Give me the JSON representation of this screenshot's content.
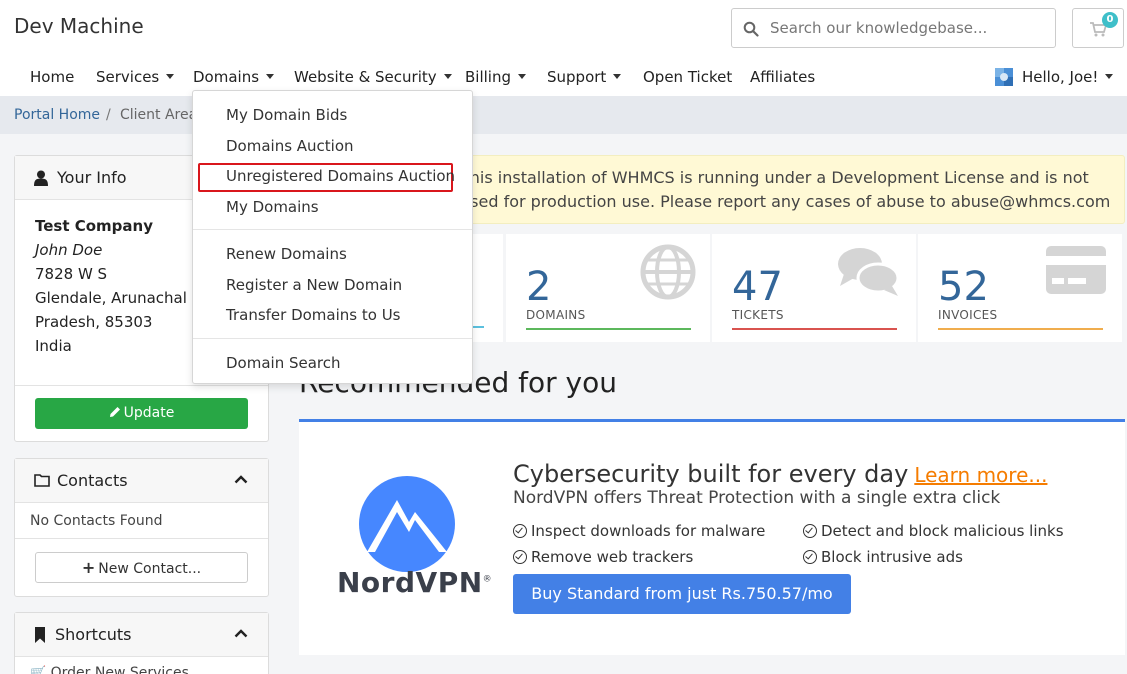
{
  "header": {
    "brand": "Dev Machine",
    "search_placeholder": "Search our knowledgebase...",
    "cart_count": "0"
  },
  "nav": {
    "home": "Home",
    "services": "Services",
    "domains": "Domains",
    "website_security": "Website & Security",
    "billing": "Billing",
    "support": "Support",
    "open_ticket": "Open Ticket",
    "affiliates": "Affiliates",
    "user": "Hello, Joe!"
  },
  "breadcrumb": {
    "portal_home": "Portal Home",
    "separator": "/",
    "client_area": "Client Area"
  },
  "domains_menu": {
    "items": [
      "My Domain Bids",
      "Domains Auction",
      "Unregistered Domains Auction",
      "My Domains",
      "Renew Domains",
      "Register a New Domain",
      "Transfer Domains to Us",
      "Domain Search"
    ],
    "highlighted": "Unregistered Domains Auction"
  },
  "your_info": {
    "title": "Your Info",
    "company": "Test Company",
    "name": "John Doe",
    "address1": "7828 W S",
    "address2": "Glendale, Arunachal",
    "address3": "Pradesh, 85303",
    "country": "India",
    "update_button": "Update"
  },
  "contacts": {
    "title": "Contacts",
    "empty": "No Contacts Found",
    "new_button": "New Contact..."
  },
  "shortcuts": {
    "title": "Shortcuts",
    "item1": "Order New Services"
  },
  "alert": {
    "line1": "This installation of WHMCS is running under a Development License and is not",
    "line2": "used for production use. Please report any cases of abuse to abuse@whmcs.com"
  },
  "stats": {
    "domains": {
      "value": "2",
      "label": "DOMAINS",
      "color": "#5cb85c"
    },
    "tickets": {
      "value": "47",
      "label": "TICKETS",
      "color": "#d9534f"
    },
    "invoices": {
      "value": "52",
      "label": "INVOICES",
      "color": "#f0ad4e"
    },
    "services_color": "#5bc0de"
  },
  "recommended": {
    "title": "Recommended for you",
    "headline": "Cybersecurity built for every day",
    "learn_more": "Learn more...",
    "subheadline": "NordVPN offers Threat Protection with a single extra click",
    "features": [
      "Inspect downloads for malware",
      "Detect and block malicious links",
      "Remove web trackers",
      "Block intrusive ads"
    ],
    "buy_button": "Buy Standard from just Rs.750.57/mo",
    "logo_text": "NordVPN",
    "logo_mark": "®"
  }
}
